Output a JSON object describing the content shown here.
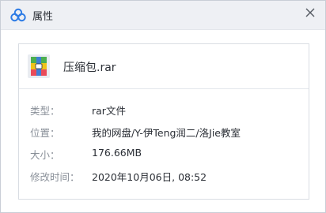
{
  "window": {
    "title": "属性",
    "app_icon": "cloud-logo-icon",
    "close_icon": "close-icon"
  },
  "file": {
    "name": "压缩包.rar",
    "icon": "rar-archive-icon"
  },
  "properties": [
    {
      "label": "类型：",
      "value": "rar文件"
    },
    {
      "label": "位置：",
      "value": "我的网盘/Y-伊Teng润二/洛Jie教室"
    },
    {
      "label": "大小：",
      "value": "176.66MB"
    },
    {
      "label": "修改时间：",
      "value": "2020年10月06日, 08:52"
    }
  ],
  "colors": {
    "titlebar_bg": "#eef0f4",
    "label_text": "#8a9099",
    "value_text": "#2b2f36",
    "logo_blue": "#2c7be5"
  }
}
